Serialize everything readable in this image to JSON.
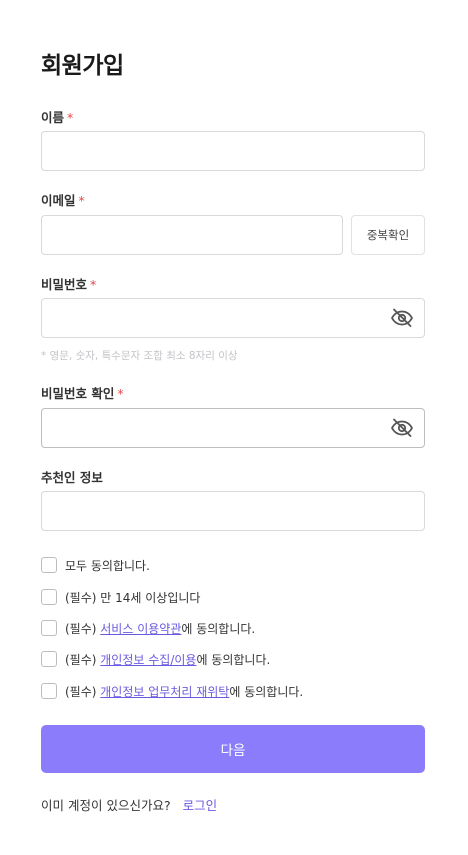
{
  "page_title": "회원가입",
  "required_mark": "*",
  "fields": {
    "name": {
      "label": "이름",
      "value": ""
    },
    "email": {
      "label": "이메일",
      "value": "",
      "dup_check_label": "중복확인"
    },
    "password": {
      "label": "비밀번호",
      "value": "",
      "hint": "* 영문, 숫자, 특수문자 조합 최소 8자리 이상"
    },
    "password_confirm": {
      "label": "비밀번호 확인",
      "value": ""
    },
    "referral": {
      "label": "추천인 정보",
      "value": ""
    }
  },
  "agreements": {
    "all": {
      "text": "모두 동의합니다."
    },
    "age": {
      "text": "(필수) 만 14세 이상입니다"
    },
    "terms": {
      "prefix": "(필수) ",
      "link": "서비스 이용약관",
      "suffix": "에 동의합니다."
    },
    "privacy": {
      "prefix": "(필수) ",
      "link": "개인정보 수집/이용",
      "suffix": "에 동의합니다."
    },
    "outsourcing": {
      "prefix": "(필수) ",
      "link": "개인정보 업무처리 재위탁",
      "suffix": "에 동의합니다."
    }
  },
  "next_button": "다음",
  "footer": {
    "question": "이미 계정이 있으신가요?",
    "login_link": "로그인"
  },
  "colors": {
    "accent": "#8b7cfb",
    "link": "#6a5ae0",
    "required": "#e5484d"
  },
  "icons": {
    "password_toggle": "eye-off-icon"
  }
}
